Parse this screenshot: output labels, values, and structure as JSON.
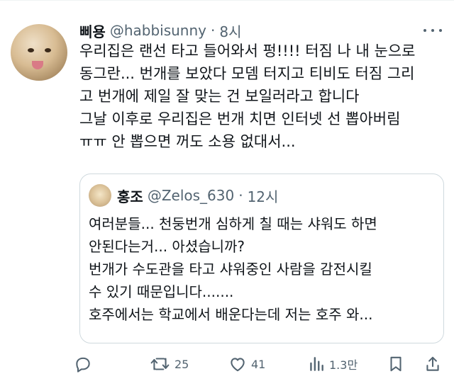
{
  "tweet": {
    "name": "삐용",
    "handle": "@habbisunny",
    "dot": "·",
    "time": "8시",
    "lines": [
      "우리집은 랜선 타고 들어와서 펑!!!! 터짐 나 내 눈으로",
      "동그란... 번개를 보았다 모뎀 터지고 티비도 터짐 그리",
      "고 번개에 제일 잘 맞는 건 보일러라고 합니다",
      "그날 이후로 우리집은 번개 치면 인터넷 선 뽑아버림",
      "ㅠㅠ 안 뽑으면 꺼도 소용 없대서..."
    ]
  },
  "quote": {
    "name": "홍조",
    "handle": "@Zelos_630",
    "dot": "·",
    "time": "12시",
    "lines": [
      "여러분들... 천둥번개 심하게 칠 때는 샤워도 하면",
      "안된다는거... 아셨습니까?",
      "번개가 수도관을 타고 샤워중인 사람을 감전시킬",
      "수 있기 때문입니다.......",
      "호주에서는 학교에서 배운다는데 저는 호주 와..."
    ]
  },
  "actions": {
    "reply_icon": "reply-icon",
    "retweet_icon": "retweet-icon",
    "retweet_count": "25",
    "like_icon": "heart-icon",
    "like_count": "41",
    "views_icon": "views-icon",
    "views_count": "1.3만",
    "bookmark_icon": "bookmark-icon",
    "share_icon": "share-icon"
  },
  "colors": {
    "text": "#0f1419",
    "muted": "#536471",
    "border": "#cfd9de"
  }
}
